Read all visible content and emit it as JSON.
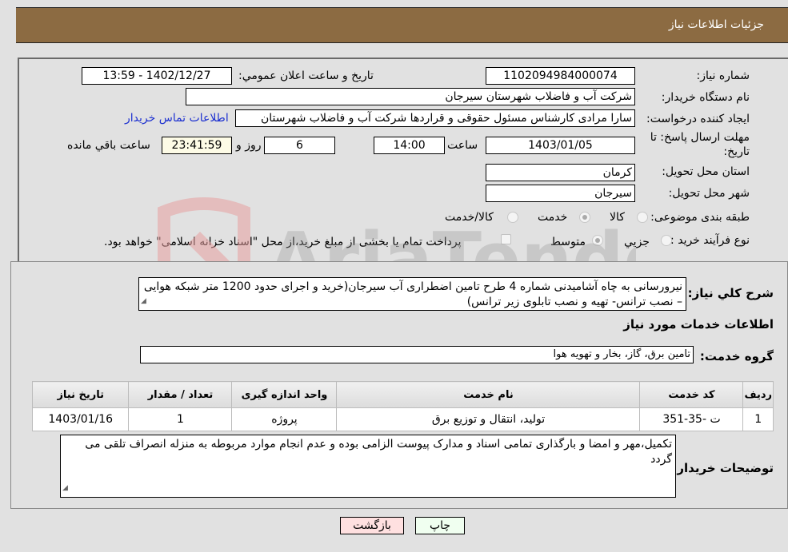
{
  "header": {
    "title": "جزئیات اطلاعات نیاز"
  },
  "form": {
    "need_number": {
      "label": "شماره نیاز:",
      "value": "1102094984000074"
    },
    "announce_datetime": {
      "label": "تاريخ و ساعت اعلان عمومي:",
      "value": "1402/12/27 - 13:59"
    },
    "buyer_org": {
      "label": "نام دستگاه خريدار:",
      "value": "شرکت آب و فاضلاب شهرستان سیرجان"
    },
    "requester": {
      "label": "ايجاد کننده درخواست:",
      "value": "سارا مرادی کارشناس مسئول حقوقی و قراردها شرکت آب و فاضلاب شهرستان",
      "contact_link": "اطلاعات تماس خريدار"
    },
    "deadline": {
      "label_line1": "مهلت ارسال پاسخ: تا",
      "label_line2": "تاريخ:",
      "date": "1403/01/05",
      "time_label": "ساعت",
      "time": "14:00",
      "days": "6",
      "days_label": "روز و",
      "remaining": "23:41:59",
      "remaining_label": "ساعت باقي مانده"
    },
    "province": {
      "label": "استان محل تحويل:",
      "value": "کرمان"
    },
    "city": {
      "label": "شهر محل تحويل:",
      "value": "سیرجان"
    },
    "category": {
      "label": "طبقه بندی موضوعی:",
      "options": [
        "کالا",
        "خدمت",
        "کالا/خدمت"
      ],
      "selected": "خدمت"
    },
    "purchase_type": {
      "label": "نوع فرآيند خريد :",
      "options": [
        "جزيي",
        "متوسط"
      ],
      "selected": "متوسط",
      "treasury_note": "پرداخت تمام يا بخشی از مبلغ خريد،از محل \"اسناد خزانه اسلامی\" خواهد بود."
    }
  },
  "description": {
    "label": "شرح كلي نياز:",
    "value": "نیرورسانی به چاه آشامیدنی  شماره 4 طرح تامین اضطراری آب سیرجان(خرید و اجرای حدود 1200 متر شبکه هوایی – نصب ترانس- تهیه و نصب  تابلوی زیر ترانس)"
  },
  "services_section": {
    "title": "اطلاعات خدمات مورد نياز",
    "group_label": "گروه خدمت:",
    "group_value": "تامین برق، گاز، بخار و تهویه هوا",
    "table": {
      "headers": [
        "رديف",
        "كد خدمت",
        "نام خدمت",
        "واحد اندازه گيری",
        "تعداد / مقدار",
        "تاريخ نياز"
      ],
      "rows": [
        [
          "1",
          "ت -35-351",
          "تولید، انتقال و توزیع برق",
          "پروژه",
          "1",
          "1403/01/16"
        ]
      ]
    }
  },
  "buyer_notes": {
    "label": "توضيحات خريدار:",
    "value": "تکمیل،مهر و امضا و بارگذاری تمامی اسناد و مدارک پیوست الزامی بوده و عدم انجام موارد مربوطه به منزله انصراف تلقی می گردد"
  },
  "buttons": {
    "print": "چاپ",
    "back": "بازگشت"
  },
  "colors": {
    "header_bg": "#8c6b42",
    "link": "#1b2fd0",
    "print_bg": "#f0fff0",
    "back_bg": "#ffe0e0"
  }
}
